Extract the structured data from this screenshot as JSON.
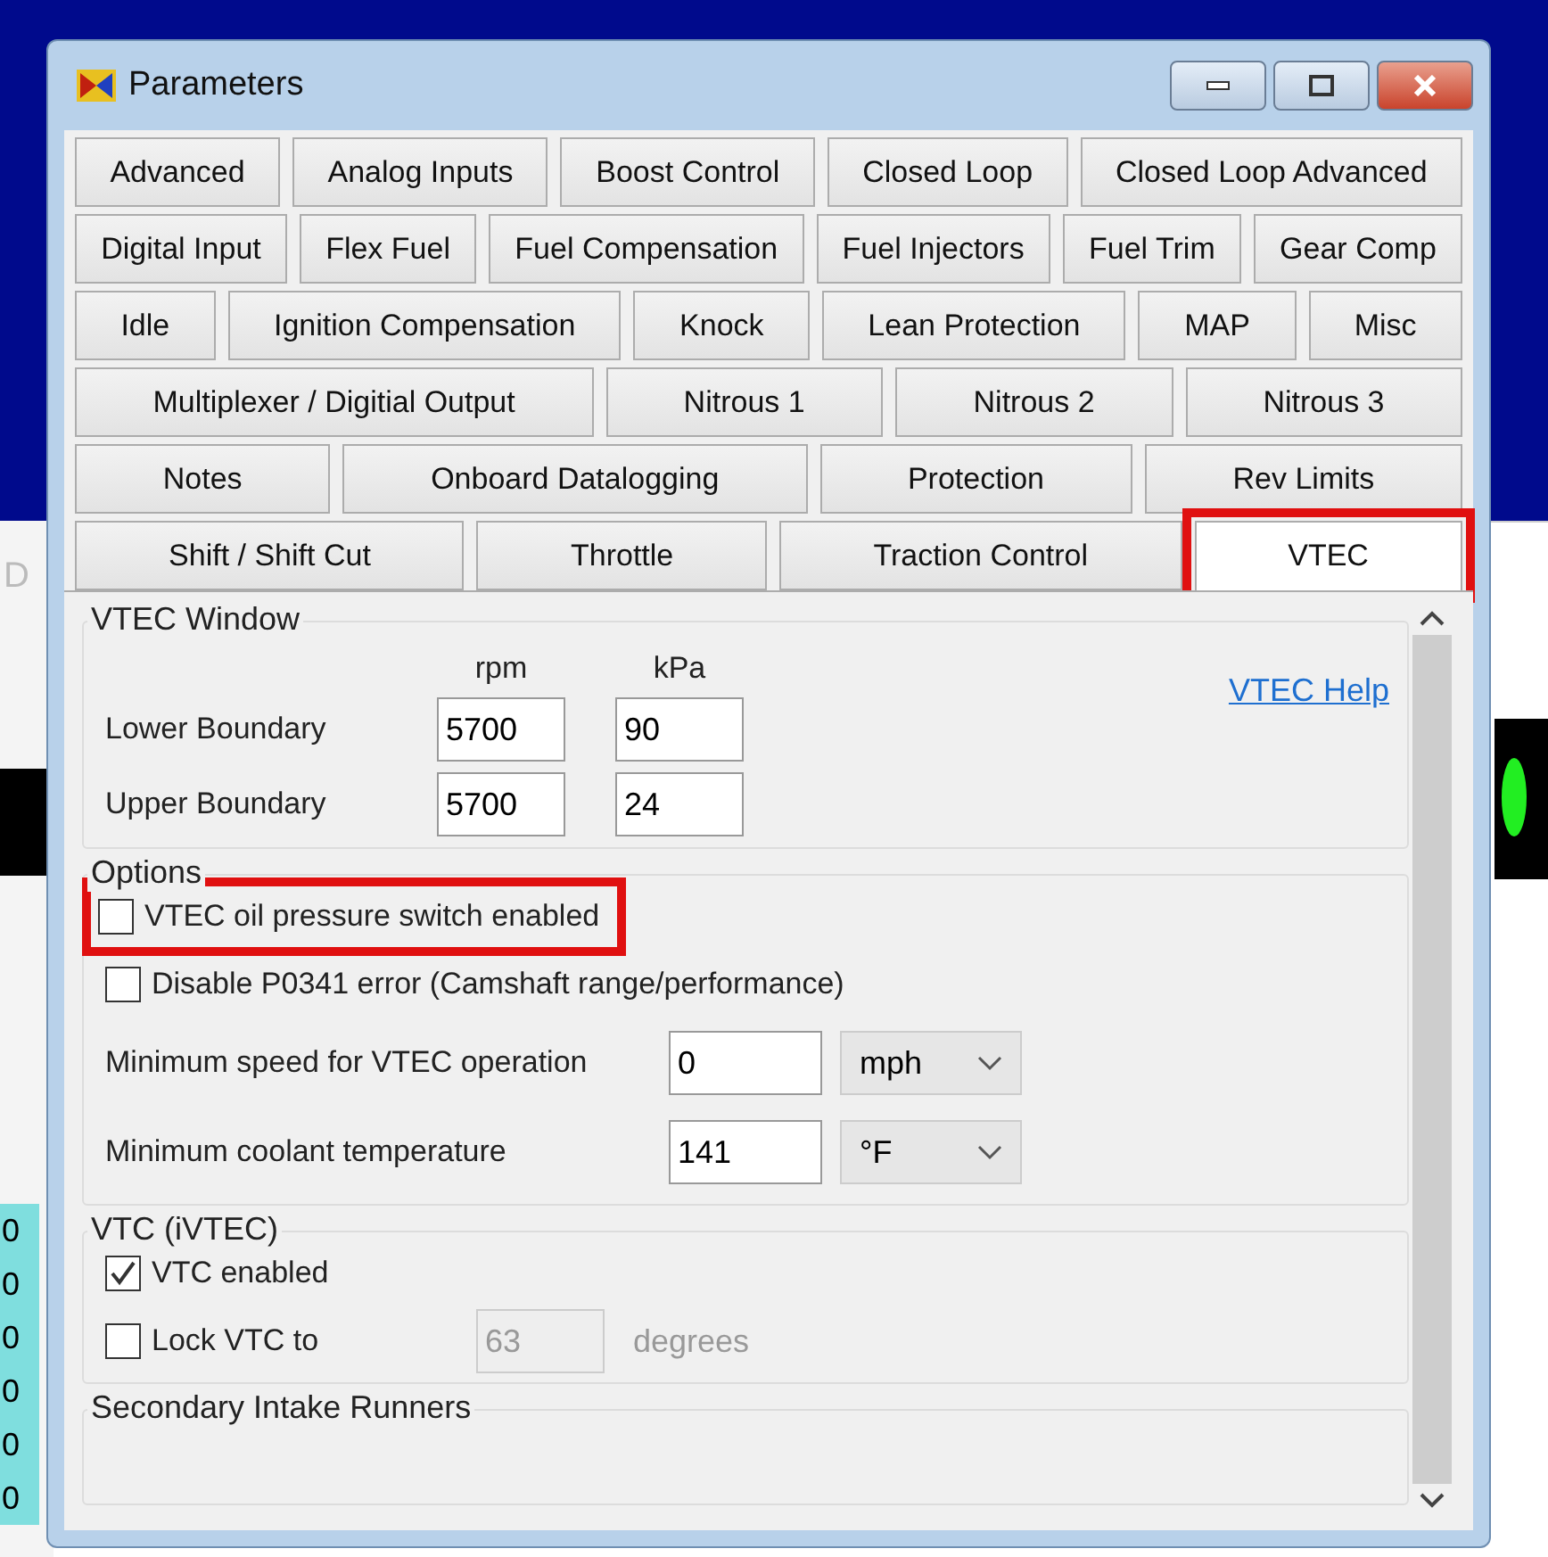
{
  "background": {
    "fragment_text": "D",
    "cells": [
      "0",
      "0",
      "0",
      "0",
      "0",
      "0"
    ]
  },
  "window": {
    "title": "Parameters"
  },
  "tab_rows": [
    [
      {
        "label": "Advanced",
        "selected": false,
        "highlighted": false
      },
      {
        "label": "Analog Inputs",
        "selected": false,
        "highlighted": false
      },
      {
        "label": "Boost Control",
        "selected": false,
        "highlighted": false
      },
      {
        "label": "Closed Loop",
        "selected": false,
        "highlighted": false
      },
      {
        "label": "Closed Loop Advanced",
        "selected": false,
        "highlighted": false
      }
    ],
    [
      {
        "label": "Digital Input",
        "selected": false,
        "highlighted": false
      },
      {
        "label": "Flex Fuel",
        "selected": false,
        "highlighted": false
      },
      {
        "label": "Fuel Compensation",
        "selected": false,
        "highlighted": false
      },
      {
        "label": "Fuel Injectors",
        "selected": false,
        "highlighted": false
      },
      {
        "label": "Fuel Trim",
        "selected": false,
        "highlighted": false
      },
      {
        "label": "Gear Comp",
        "selected": false,
        "highlighted": false
      }
    ],
    [
      {
        "label": "Idle",
        "selected": false,
        "highlighted": false
      },
      {
        "label": "Ignition Compensation",
        "selected": false,
        "highlighted": false
      },
      {
        "label": "Knock",
        "selected": false,
        "highlighted": false
      },
      {
        "label": "Lean Protection",
        "selected": false,
        "highlighted": false
      },
      {
        "label": "MAP",
        "selected": false,
        "highlighted": false
      },
      {
        "label": "Misc",
        "selected": false,
        "highlighted": false
      }
    ],
    [
      {
        "label": "Multiplexer / Digitial Output",
        "selected": false,
        "highlighted": false
      },
      {
        "label": "Nitrous 1",
        "selected": false,
        "highlighted": false
      },
      {
        "label": "Nitrous 2",
        "selected": false,
        "highlighted": false
      },
      {
        "label": "Nitrous 3",
        "selected": false,
        "highlighted": false
      }
    ],
    [
      {
        "label": "Notes",
        "selected": false,
        "highlighted": false
      },
      {
        "label": "Onboard Datalogging",
        "selected": false,
        "highlighted": false
      },
      {
        "label": "Protection",
        "selected": false,
        "highlighted": false
      },
      {
        "label": "Rev Limits",
        "selected": false,
        "highlighted": false
      }
    ],
    [
      {
        "label": "Shift / Shift Cut",
        "selected": false,
        "highlighted": false
      },
      {
        "label": "Throttle",
        "selected": false,
        "highlighted": false
      },
      {
        "label": "Traction Control",
        "selected": false,
        "highlighted": false
      },
      {
        "label": "VTEC",
        "selected": true,
        "highlighted": true
      }
    ]
  ],
  "vtec_window": {
    "title": "VTEC Window",
    "help_link": "VTEC Help",
    "col_rpm": "rpm",
    "col_kpa": "kPa",
    "rows": [
      {
        "label": "Lower Boundary",
        "rpm": "5700",
        "kpa": "90"
      },
      {
        "label": "Upper Boundary",
        "rpm": "5700",
        "kpa": "24"
      }
    ]
  },
  "options": {
    "title": "Options",
    "checkboxes": [
      {
        "label": "VTEC oil pressure switch enabled",
        "checked": false,
        "highlighted": true
      },
      {
        "label": "Disable P0341 error (Camshaft range/performance)",
        "checked": false,
        "highlighted": false
      }
    ],
    "fields": [
      {
        "label": "Minimum speed for VTEC operation",
        "value": "0",
        "unit": "mph"
      },
      {
        "label": "Minimum coolant temperature",
        "value": "141",
        "unit": "°F"
      }
    ]
  },
  "vtc": {
    "title": "VTC (iVTEC)",
    "enabled": {
      "label": "VTC enabled",
      "checked": true
    },
    "lock": {
      "label": "Lock VTC to",
      "checked": false,
      "value": "63",
      "unit": "degrees"
    }
  },
  "secondary_intake": {
    "title": "Secondary Intake Runners"
  }
}
